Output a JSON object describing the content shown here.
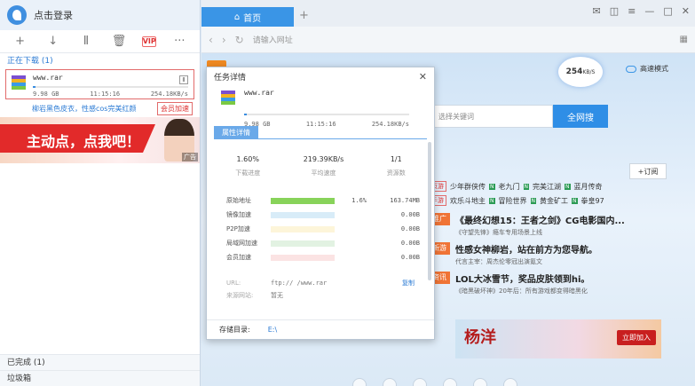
{
  "app": {
    "login_text": "点击登录",
    "toolbar": [
      {
        "name": "add-task-button",
        "glyph": "+"
      },
      {
        "name": "start-button",
        "glyph": "↓"
      },
      {
        "name": "pause-button",
        "glyph": "Ⅱ"
      },
      {
        "name": "delete-button",
        "glyph": "🗑"
      },
      {
        "name": "vip-button",
        "glyph": "VIP"
      },
      {
        "name": "more-button",
        "glyph": "···"
      }
    ]
  },
  "downloading": {
    "label": "正在下载 (1)",
    "item": {
      "name": "www.rar",
      "size": "9.98 GB",
      "time": "11:15:16",
      "speed": "254.18KB/s",
      "progress": 0.016
    },
    "promo_text": "柳岩黑色皮衣，性感cos完美红颜",
    "vip_label": "会员加速"
  },
  "banner": {
    "text": "主动点，点我吧！",
    "ad": "广告"
  },
  "completed_label": "已完成 (1)",
  "trash_label": "垃圾箱",
  "browser": {
    "tab_label": "首页",
    "url_placeholder": "请输入网址",
    "speed": "254",
    "speed_unit": "KB/S",
    "high_speed_mode": "高速模式",
    "search_placeholder": "选择关键词",
    "search_button": "全网搜",
    "subscribe": "+订阅",
    "categories": [
      {
        "tag": "页游",
        "items": [
          "少年群侠传",
          "老九门",
          "完美江湖",
          "蓝月传奇"
        ]
      },
      {
        "tag": "手游",
        "items": [
          "欢乐斗地主",
          "冒险世界",
          "黄金矿工",
          "拳皇97"
        ]
      }
    ],
    "news": [
      {
        "tag": "推广",
        "title": "《最终幻想15：王者之剑》CG电影国内...",
        "sub": "《守望先锋》瘾车专用场景上线"
      },
      {
        "tag": "新游",
        "title": "性感女神柳岩，站在前方为您导航。",
        "sub": "代言主宰：周杰伦零冠出演氪文"
      },
      {
        "tag": "资讯",
        "title": "LOL大冰雪节，奖品皮肤领到hi。",
        "sub": "《暗黑破坏神》20年后：所有游戏都变得暗黑化"
      }
    ],
    "ad_title": "杨洋",
    "ad_button": "立即加入"
  },
  "dialog": {
    "title": "任务详情",
    "close": "✕",
    "file_name": "www.rar",
    "size": "9.98 GB",
    "time": "11:15:16",
    "speed": "254.18KB/s",
    "progress": 0.016,
    "tab_label": "属性详情",
    "stats": [
      {
        "value": "1.60%",
        "label": "下载进度"
      },
      {
        "value": "219.39KB/s",
        "label": "平均速度"
      },
      {
        "value": "1/1",
        "label": "资源数"
      }
    ],
    "sources": [
      {
        "name": "原始地址",
        "pct": "1.6%",
        "size": "163.74MB",
        "color": "#88d35a",
        "fill": 1.0
      },
      {
        "name": "镜像加速",
        "pct": "",
        "size": "0.00B",
        "color": "#d8ecf8",
        "fill": 1.0
      },
      {
        "name": "P2P加速",
        "pct": "",
        "size": "0.00B",
        "color": "#fdf5d9",
        "fill": 1.0
      },
      {
        "name": "局域网加速",
        "pct": "",
        "size": "0.00B",
        "color": "#e2f2e2",
        "fill": 1.0
      },
      {
        "name": "会员加速",
        "pct": "",
        "size": "0.00B",
        "color": "#fbe3e3",
        "fill": 1.0
      }
    ],
    "url_label": "URL:",
    "url_value": "ftp://             /www.rar",
    "copy_label": "复制",
    "site_label": "来源网站:",
    "site_value": "暂无",
    "dir_label": "存储目录:",
    "dir_value": "E:\\"
  }
}
